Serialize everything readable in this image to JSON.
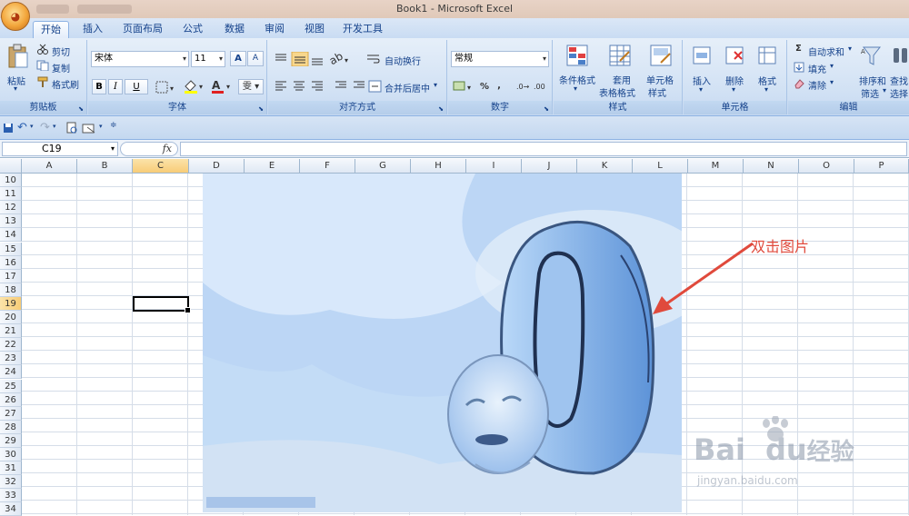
{
  "window": {
    "title": "Book1 - Microsoft Excel"
  },
  "office_button": {
    "icon": "office-logo-icon"
  },
  "tabs": [
    "开始",
    "插入",
    "页面布局",
    "公式",
    "数据",
    "审阅",
    "视图",
    "开发工具"
  ],
  "ribbon": {
    "clipboard": {
      "label": "剪贴板",
      "paste": "粘贴",
      "cut": "剪切",
      "copy": "复制",
      "format_painter": "格式刷"
    },
    "font": {
      "label": "字体",
      "font_name": "宋体",
      "font_size": "11",
      "bold": "B",
      "italic": "I",
      "underline": "U",
      "grow": "A",
      "shrink": "A",
      "phonetic": "雯"
    },
    "alignment": {
      "label": "对齐方式",
      "wrap_text": "自动换行",
      "merge_center": "合并后居中"
    },
    "number": {
      "label": "数字",
      "format": "常规",
      "percent": "%",
      "comma": ","
    },
    "styles": {
      "label": "样式",
      "conditional": "条件格式",
      "table_line1": "套用",
      "table_line2": "表格格式",
      "cell_line1": "单元格",
      "cell_line2": "样式"
    },
    "cells": {
      "label": "单元格",
      "insert": "插入",
      "delete": "删除",
      "format": "格式"
    },
    "editing": {
      "label": "编辑",
      "autosum": "自动求和",
      "fill": "填充",
      "clear": "清除",
      "sort_line1": "排序和",
      "sort_line2": "筛选",
      "find_line1": "查找",
      "find_line2": "选择"
    }
  },
  "formula_bar": {
    "name_box": "C19",
    "fx": "fx",
    "value": ""
  },
  "columns": [
    "A",
    "B",
    "C",
    "D",
    "E",
    "F",
    "G",
    "H",
    "I",
    "J",
    "K",
    "L",
    "M",
    "N",
    "O",
    "P"
  ],
  "rows": [
    "10",
    "11",
    "12",
    "13",
    "14",
    "15",
    "16",
    "17",
    "18",
    "19",
    "20",
    "21",
    "22",
    "23",
    "24",
    "25",
    "26",
    "27",
    "28",
    "29",
    "30",
    "31",
    "32",
    "33",
    "34"
  ],
  "selected_cell": {
    "column": "C",
    "row": "19"
  },
  "annotation": {
    "text": "双击图片",
    "color": "#e04a3c"
  },
  "watermark": {
    "brand": "Bai",
    "brand2": "du",
    "cn": "经验",
    "url": "jingyan.baidu.com"
  },
  "colors": {
    "ribbon": "#d1e1f4",
    "accent": "#15428b",
    "selection_header": "#f8cc77",
    "arrow": "#e04a3c"
  }
}
